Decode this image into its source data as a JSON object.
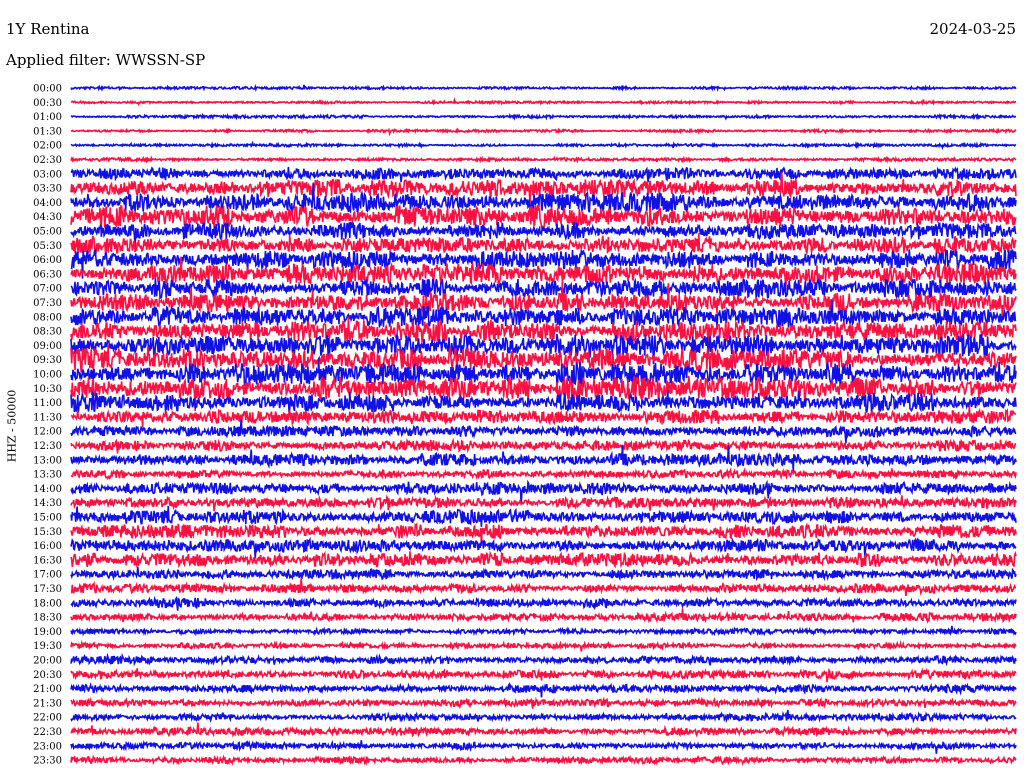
{
  "header": {
    "station": "1Y Rentina",
    "date": "2024-03-25",
    "filter": "Applied filter: WWSSN-SP"
  },
  "colors": {
    "trace_a": "#1010e8",
    "trace_b": "#ff1040",
    "text": "#000000",
    "background": "#ffffff"
  },
  "chart_data": {
    "type": "line",
    "title": "",
    "ylabel": "HHZ - 50000",
    "xlabel": "",
    "grid": false,
    "legend": "none",
    "rows": [
      {
        "time": "00:00",
        "color": "blue",
        "noise": 0.9
      },
      {
        "time": "00:30",
        "color": "red",
        "noise": 0.9
      },
      {
        "time": "01:00",
        "color": "blue",
        "noise": 1.0
      },
      {
        "time": "01:30",
        "color": "red",
        "noise": 0.9
      },
      {
        "time": "02:00",
        "color": "blue",
        "noise": 1.0
      },
      {
        "time": "02:30",
        "color": "red",
        "noise": 1.2
      },
      {
        "time": "03:00",
        "color": "blue",
        "noise": 4.5
      },
      {
        "time": "03:30",
        "color": "red",
        "noise": 6.5
      },
      {
        "time": "04:00",
        "color": "blue",
        "noise": 7.0
      },
      {
        "time": "04:30",
        "color": "red",
        "noise": 8.0
      },
      {
        "time": "05:00",
        "color": "blue",
        "noise": 6.0
      },
      {
        "time": "05:30",
        "color": "red",
        "noise": 6.0
      },
      {
        "time": "06:00",
        "color": "blue",
        "noise": 7.0
      },
      {
        "time": "06:30",
        "color": "red",
        "noise": 7.5
      },
      {
        "time": "07:00",
        "color": "blue",
        "noise": 7.0
      },
      {
        "time": "07:30",
        "color": "red",
        "noise": 7.0
      },
      {
        "time": "08:00",
        "color": "blue",
        "noise": 7.5
      },
      {
        "time": "08:30",
        "color": "red",
        "noise": 8.0
      },
      {
        "time": "09:00",
        "color": "blue",
        "noise": 8.0
      },
      {
        "time": "09:30",
        "color": "red",
        "noise": 8.5
      },
      {
        "time": "10:00",
        "color": "blue",
        "noise": 8.5
      },
      {
        "time": "10:30",
        "color": "red",
        "noise": 8.0
      },
      {
        "time": "11:00",
        "color": "blue",
        "noise": 7.0
      },
      {
        "time": "11:30",
        "color": "red",
        "noise": 5.0
      },
      {
        "time": "12:00",
        "color": "blue",
        "noise": 4.0
      },
      {
        "time": "12:30",
        "color": "red",
        "noise": 4.0
      },
      {
        "time": "13:00",
        "color": "blue",
        "noise": 4.5
      },
      {
        "time": "13:30",
        "color": "red",
        "noise": 3.0
      },
      {
        "time": "14:00",
        "color": "blue",
        "noise": 4.5
      },
      {
        "time": "14:30",
        "color": "red",
        "noise": 4.0
      },
      {
        "time": "15:00",
        "color": "blue",
        "noise": 5.0
      },
      {
        "time": "15:30",
        "color": "red",
        "noise": 5.5
      },
      {
        "time": "16:00",
        "color": "blue",
        "noise": 4.5
      },
      {
        "time": "16:30",
        "color": "red",
        "noise": 5.0
      },
      {
        "time": "17:00",
        "color": "blue",
        "noise": 3.5
      },
      {
        "time": "17:30",
        "color": "red",
        "noise": 3.5
      },
      {
        "time": "18:00",
        "color": "blue",
        "noise": 3.5
      },
      {
        "time": "18:30",
        "color": "red",
        "noise": 3.0
      },
      {
        "time": "19:00",
        "color": "blue",
        "noise": 2.0
      },
      {
        "time": "19:30",
        "color": "red",
        "noise": 2.0
      },
      {
        "time": "20:00",
        "color": "blue",
        "noise": 3.0
      },
      {
        "time": "20:30",
        "color": "red",
        "noise": 3.0
      },
      {
        "time": "21:00",
        "color": "blue",
        "noise": 3.0
      },
      {
        "time": "21:30",
        "color": "red",
        "noise": 2.5
      },
      {
        "time": "22:00",
        "color": "blue",
        "noise": 2.5
      },
      {
        "time": "22:30",
        "color": "red",
        "noise": 3.0
      },
      {
        "time": "23:00",
        "color": "blue",
        "noise": 2.5
      },
      {
        "time": "23:30",
        "color": "red",
        "noise": 2.5
      }
    ]
  }
}
